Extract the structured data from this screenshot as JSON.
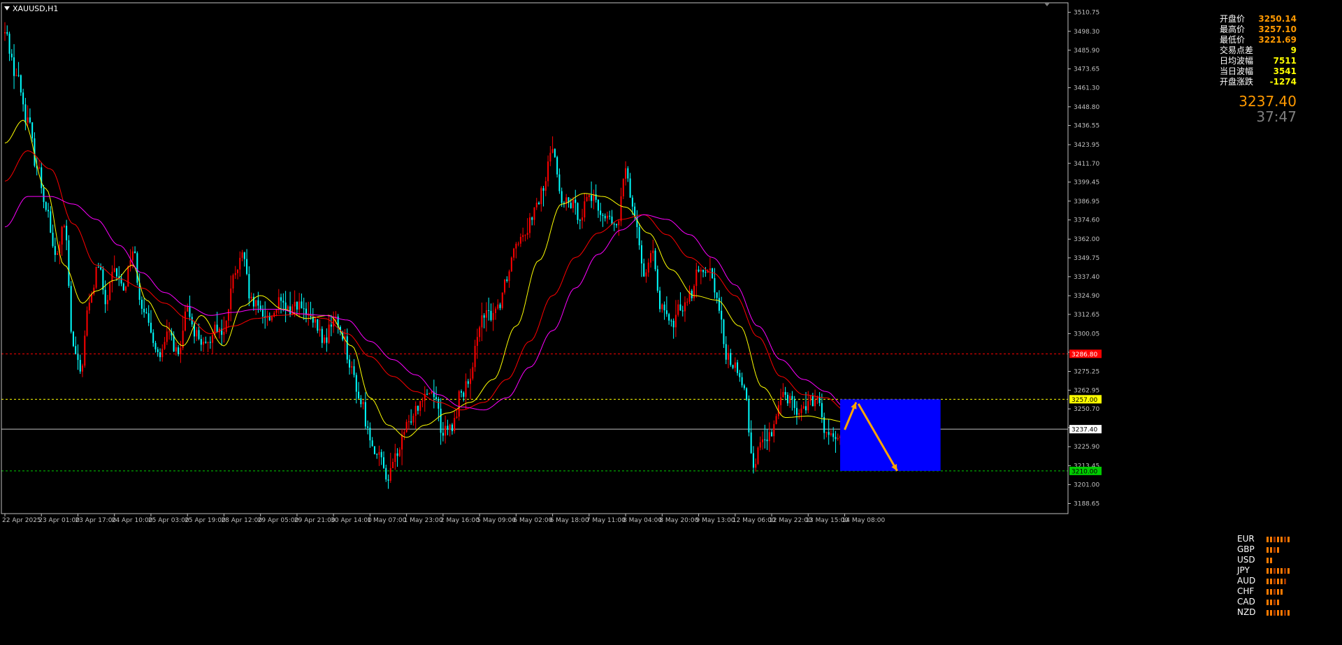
{
  "symbol": "XAUUSD,H1",
  "info": [
    {
      "label": "开盘价",
      "value": "3250.14",
      "color": "#ff9900"
    },
    {
      "label": "最高价",
      "value": "3257.10",
      "color": "#ff9900"
    },
    {
      "label": "最低价",
      "value": "3221.69",
      "color": "#ff9900"
    },
    {
      "label": "交易点差",
      "value": "9",
      "color": "#ffff00"
    },
    {
      "label": "日均波幅",
      "value": "7511",
      "color": "#ffff00"
    },
    {
      "label": "当日波幅",
      "value": "3541",
      "color": "#ffff00"
    },
    {
      "label": "开盘涨跌",
      "value": "-1274",
      "color": "#ffff00"
    }
  ],
  "current_price": "3237.40",
  "countdown": "37:47",
  "currencies": [
    {
      "name": "EUR",
      "strength": 7
    },
    {
      "name": "GBP",
      "strength": 4
    },
    {
      "name": "USD",
      "strength": 2
    },
    {
      "name": "JPY",
      "strength": 7
    },
    {
      "name": "AUD",
      "strength": 6
    },
    {
      "name": "CHF",
      "strength": 5
    },
    {
      "name": "CAD",
      "strength": 4
    },
    {
      "name": "NZD",
      "strength": 7
    }
  ],
  "colors": {
    "bull": "#ff0000",
    "bear": "#00ffff",
    "ma_fast": "#ffff00",
    "ma_mid": "#ff0000",
    "ma_slow": "#ff00ff",
    "box": "#0000ff",
    "arrow": "#ffa500",
    "grid_axis": "#c0c0c0"
  },
  "chart_data": {
    "type": "candlestick",
    "title": "XAUUSD,H1",
    "ylim": [
      3182.0,
      3517.0
    ],
    "y_ticks": [
      "3510.75",
      "3498.30",
      "3485.90",
      "3473.65",
      "3461.30",
      "3448.80",
      "3436.55",
      "3423.95",
      "3411.70",
      "3399.45",
      "3386.95",
      "3374.60",
      "3362.00",
      "3349.75",
      "3337.40",
      "3324.90",
      "3312.65",
      "3300.05",
      "3287.85",
      "3275.25",
      "3262.95",
      "3250.70",
      "3238.45",
      "3225.90",
      "3213.45",
      "3201.00",
      "3188.65"
    ],
    "x_tick_labels": [
      "22 Apr 2025",
      "23 Apr 01:00",
      "23 Apr 17:00",
      "24 Apr 10:00",
      "25 Apr 03:00",
      "25 Apr 19:00",
      "28 Apr 12:00",
      "29 Apr 05:00",
      "29 Apr 21:00",
      "30 Apr 14:00",
      "1 May 07:00",
      "1 May 23:00",
      "2 May 16:00",
      "5 May 09:00",
      "6 May 02:00",
      "6 May 18:00",
      "7 May 11:00",
      "8 May 04:00",
      "8 May 20:00",
      "9 May 13:00",
      "12 May 06:00",
      "12 May 22:00",
      "13 May 15:00",
      "14 May 08:00"
    ],
    "x_tick_index": [
      0,
      16,
      32,
      48,
      64,
      80,
      96,
      112,
      128,
      144,
      160,
      176,
      192,
      208,
      224,
      240,
      256,
      272,
      288,
      304,
      320,
      336,
      352,
      368
    ],
    "horizontal_lines": [
      {
        "price": 3286.8,
        "label": "3286.80",
        "color": "#ff0000",
        "style": "dashed"
      },
      {
        "price": 3257.0,
        "label": "3257.00",
        "color": "#ffff00",
        "style": "dashed"
      },
      {
        "price": 3237.4,
        "label": "3237.40",
        "color": "#c0c0c0",
        "style": "solid"
      },
      {
        "price": 3210.0,
        "label": "3210.00",
        "color": "#00cc00",
        "style": "dashed"
      }
    ],
    "close_path_anchors": [
      [
        0,
        3497
      ],
      [
        5,
        3470
      ],
      [
        10,
        3440
      ],
      [
        14,
        3410
      ],
      [
        18,
        3385
      ],
      [
        22,
        3350
      ],
      [
        26,
        3370
      ],
      [
        30,
        3290
      ],
      [
        33,
        3275
      ],
      [
        37,
        3320
      ],
      [
        41,
        3345
      ],
      [
        44,
        3320
      ],
      [
        48,
        3340
      ],
      [
        52,
        3330
      ],
      [
        56,
        3355
      ],
      [
        60,
        3320
      ],
      [
        64,
        3300
      ],
      [
        68,
        3285
      ],
      [
        72,
        3300
      ],
      [
        76,
        3285
      ],
      [
        80,
        3315
      ],
      [
        84,
        3300
      ],
      [
        88,
        3290
      ],
      [
        92,
        3305
      ],
      [
        96,
        3300
      ],
      [
        100,
        3335
      ],
      [
        104,
        3350
      ],
      [
        108,
        3320
      ],
      [
        112,
        3315
      ],
      [
        116,
        3310
      ],
      [
        120,
        3320
      ],
      [
        124,
        3315
      ],
      [
        128,
        3320
      ],
      [
        132,
        3312
      ],
      [
        136,
        3305
      ],
      [
        140,
        3295
      ],
      [
        144,
        3310
      ],
      [
        148,
        3300
      ],
      [
        152,
        3275
      ],
      [
        156,
        3255
      ],
      [
        160,
        3232
      ],
      [
        164,
        3218
      ],
      [
        168,
        3206
      ],
      [
        172,
        3222
      ],
      [
        176,
        3238
      ],
      [
        180,
        3252
      ],
      [
        184,
        3262
      ],
      [
        188,
        3262
      ],
      [
        192,
        3235
      ],
      [
        196,
        3238
      ],
      [
        200,
        3262
      ],
      [
        204,
        3268
      ],
      [
        208,
        3308
      ],
      [
        212,
        3312
      ],
      [
        216,
        3318
      ],
      [
        220,
        3338
      ],
      [
        224,
        3362
      ],
      [
        228,
        3368
      ],
      [
        232,
        3380
      ],
      [
        236,
        3395
      ],
      [
        240,
        3425
      ],
      [
        244,
        3385
      ],
      [
        248,
        3385
      ],
      [
        252,
        3378
      ],
      [
        256,
        3392
      ],
      [
        260,
        3382
      ],
      [
        264,
        3375
      ],
      [
        268,
        3370
      ],
      [
        272,
        3405
      ],
      [
        276,
        3380
      ],
      [
        280,
        3340
      ],
      [
        284,
        3350
      ],
      [
        288,
        3315
      ],
      [
        292,
        3305
      ],
      [
        296,
        3318
      ],
      [
        300,
        3325
      ],
      [
        304,
        3340
      ],
      [
        308,
        3345
      ],
      [
        312,
        3325
      ],
      [
        316,
        3285
      ],
      [
        320,
        3278
      ],
      [
        324,
        3262
      ],
      [
        328,
        3215
      ],
      [
        332,
        3232
      ],
      [
        336,
        3232
      ],
      [
        340,
        3262
      ],
      [
        344,
        3258
      ],
      [
        348,
        3248
      ],
      [
        352,
        3255
      ],
      [
        356,
        3255
      ],
      [
        360,
        3235
      ],
      [
        364,
        3228
      ],
      [
        367,
        3237.4
      ]
    ],
    "ma_fast_anchors": [
      [
        0,
        3425
      ],
      [
        8,
        3440
      ],
      [
        18,
        3395
      ],
      [
        26,
        3345
      ],
      [
        34,
        3320
      ],
      [
        40,
        3328
      ],
      [
        48,
        3335
      ],
      [
        56,
        3345
      ],
      [
        62,
        3322
      ],
      [
        70,
        3305
      ],
      [
        78,
        3292
      ],
      [
        86,
        3312
      ],
      [
        96,
        3292
      ],
      [
        104,
        3318
      ],
      [
        112,
        3325
      ],
      [
        122,
        3316
      ],
      [
        132,
        3310
      ],
      [
        142,
        3312
      ],
      [
        152,
        3292
      ],
      [
        160,
        3258
      ],
      [
        168,
        3240
      ],
      [
        176,
        3232
      ],
      [
        184,
        3240
      ],
      [
        194,
        3248
      ],
      [
        204,
        3255
      ],
      [
        214,
        3270
      ],
      [
        224,
        3305
      ],
      [
        234,
        3348
      ],
      [
        244,
        3385
      ],
      [
        254,
        3392
      ],
      [
        262,
        3390
      ],
      [
        272,
        3383
      ],
      [
        282,
        3366
      ],
      [
        292,
        3342
      ],
      [
        302,
        3325
      ],
      [
        312,
        3322
      ],
      [
        322,
        3305
      ],
      [
        332,
        3265
      ],
      [
        342,
        3245
      ],
      [
        352,
        3246
      ],
      [
        360,
        3244
      ],
      [
        368,
        3242
      ]
    ],
    "ma_mid_anchors": [
      [
        0,
        3400
      ],
      [
        10,
        3420
      ],
      [
        20,
        3408
      ],
      [
        30,
        3372
      ],
      [
        40,
        3345
      ],
      [
        50,
        3336
      ],
      [
        60,
        3330
      ],
      [
        70,
        3320
      ],
      [
        80,
        3310
      ],
      [
        90,
        3300
      ],
      [
        100,
        3305
      ],
      [
        110,
        3310
      ],
      [
        120,
        3312
      ],
      [
        130,
        3313
      ],
      [
        140,
        3310
      ],
      [
        150,
        3300
      ],
      [
        160,
        3285
      ],
      [
        170,
        3272
      ],
      [
        180,
        3262
      ],
      [
        190,
        3255
      ],
      [
        200,
        3250
      ],
      [
        210,
        3255
      ],
      [
        220,
        3270
      ],
      [
        230,
        3295
      ],
      [
        240,
        3325
      ],
      [
        250,
        3350
      ],
      [
        260,
        3366
      ],
      [
        270,
        3375
      ],
      [
        280,
        3378
      ],
      [
        290,
        3365
      ],
      [
        300,
        3350
      ],
      [
        310,
        3340
      ],
      [
        320,
        3325
      ],
      [
        330,
        3298
      ],
      [
        340,
        3272
      ],
      [
        350,
        3260
      ],
      [
        360,
        3258
      ],
      [
        368,
        3250
      ]
    ],
    "ma_slow_anchors": [
      [
        0,
        3370
      ],
      [
        10,
        3390
      ],
      [
        20,
        3390
      ],
      [
        30,
        3385
      ],
      [
        40,
        3375
      ],
      [
        50,
        3358
      ],
      [
        60,
        3340
      ],
      [
        70,
        3327
      ],
      [
        80,
        3318
      ],
      [
        90,
        3312
      ],
      [
        100,
        3314
      ],
      [
        110,
        3316
      ],
      [
        120,
        3316
      ],
      [
        130,
        3313
      ],
      [
        140,
        3312
      ],
      [
        150,
        3309
      ],
      [
        160,
        3295
      ],
      [
        170,
        3283
      ],
      [
        180,
        3273
      ],
      [
        190,
        3260
      ],
      [
        200,
        3252
      ],
      [
        210,
        3250
      ],
      [
        220,
        3258
      ],
      [
        230,
        3278
      ],
      [
        240,
        3302
      ],
      [
        250,
        3330
      ],
      [
        260,
        3352
      ],
      [
        270,
        3368
      ],
      [
        280,
        3378
      ],
      [
        290,
        3375
      ],
      [
        300,
        3365
      ],
      [
        310,
        3350
      ],
      [
        320,
        3332
      ],
      [
        330,
        3305
      ],
      [
        340,
        3283
      ],
      [
        350,
        3270
      ],
      [
        360,
        3262
      ],
      [
        368,
        3252
      ]
    ],
    "candle_count": 368,
    "projection": {
      "box_price_top": 3257.0,
      "box_price_bottom": 3210.0,
      "box_index_start": 366,
      "box_index_end": 410,
      "arrow_up_from": [
        368,
        3237
      ],
      "arrow_up_to": [
        373,
        3255
      ],
      "arrow_down_from": [
        374,
        3254
      ],
      "arrow_down_to": [
        391,
        3210
      ]
    }
  }
}
